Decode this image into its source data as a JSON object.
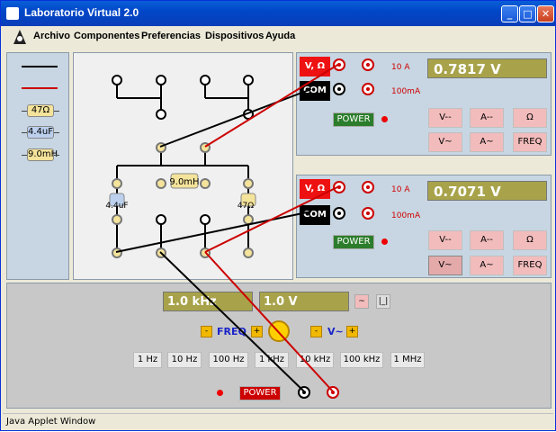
{
  "window": {
    "title": "Laboratorio Virtual 2.0",
    "status": "Java Applet Window"
  },
  "window_controls": {
    "minimize": "_",
    "maximize": "□",
    "close": "✕"
  },
  "menu": [
    "Archivo",
    "Componentes",
    "Preferencias",
    "Dispositivos",
    "Ayuda"
  ],
  "palette": {
    "resistor": "47Ω",
    "capacitor": "4.4uF",
    "inductor": "9.0mH"
  },
  "board": {
    "inductor": "9.0mH",
    "capacitor": "4.4uF",
    "resistor": "47Ω"
  },
  "meters": [
    {
      "reading": "0.7817 V",
      "jack_v": "V, Ω",
      "jack_com": "COM",
      "amp_10": "10 A",
      "amp_100": "100mA",
      "power": "POWER",
      "buttons": [
        "V--",
        "A--",
        "Ω",
        "V~",
        "A~",
        "FREQ"
      ]
    },
    {
      "reading": "0.7071 V",
      "jack_v": "V, Ω",
      "jack_com": "COM",
      "amp_10": "10 A",
      "amp_100": "100mA",
      "power": "POWER",
      "buttons": [
        "V--",
        "A--",
        "Ω",
        "V~",
        "A~",
        "FREQ"
      ]
    }
  ],
  "generator": {
    "freq_display": "1.0 kHz",
    "volt_display": "1.0 V",
    "wave_sine": "~",
    "wave_square": "|_|",
    "freq_label": "FREQ",
    "volt_label": "V~",
    "minus": "-",
    "plus": "+",
    "freq_buttons": [
      "1 Hz",
      "10 Hz",
      "100 Hz",
      "1 kHz",
      "10 kHz",
      "100 kHz",
      "1 MHz"
    ],
    "power": "POWER"
  },
  "colors": {
    "accent_red": "#cc0000",
    "lcd": "#a8a34a",
    "power_on": "#2b7d2b"
  }
}
